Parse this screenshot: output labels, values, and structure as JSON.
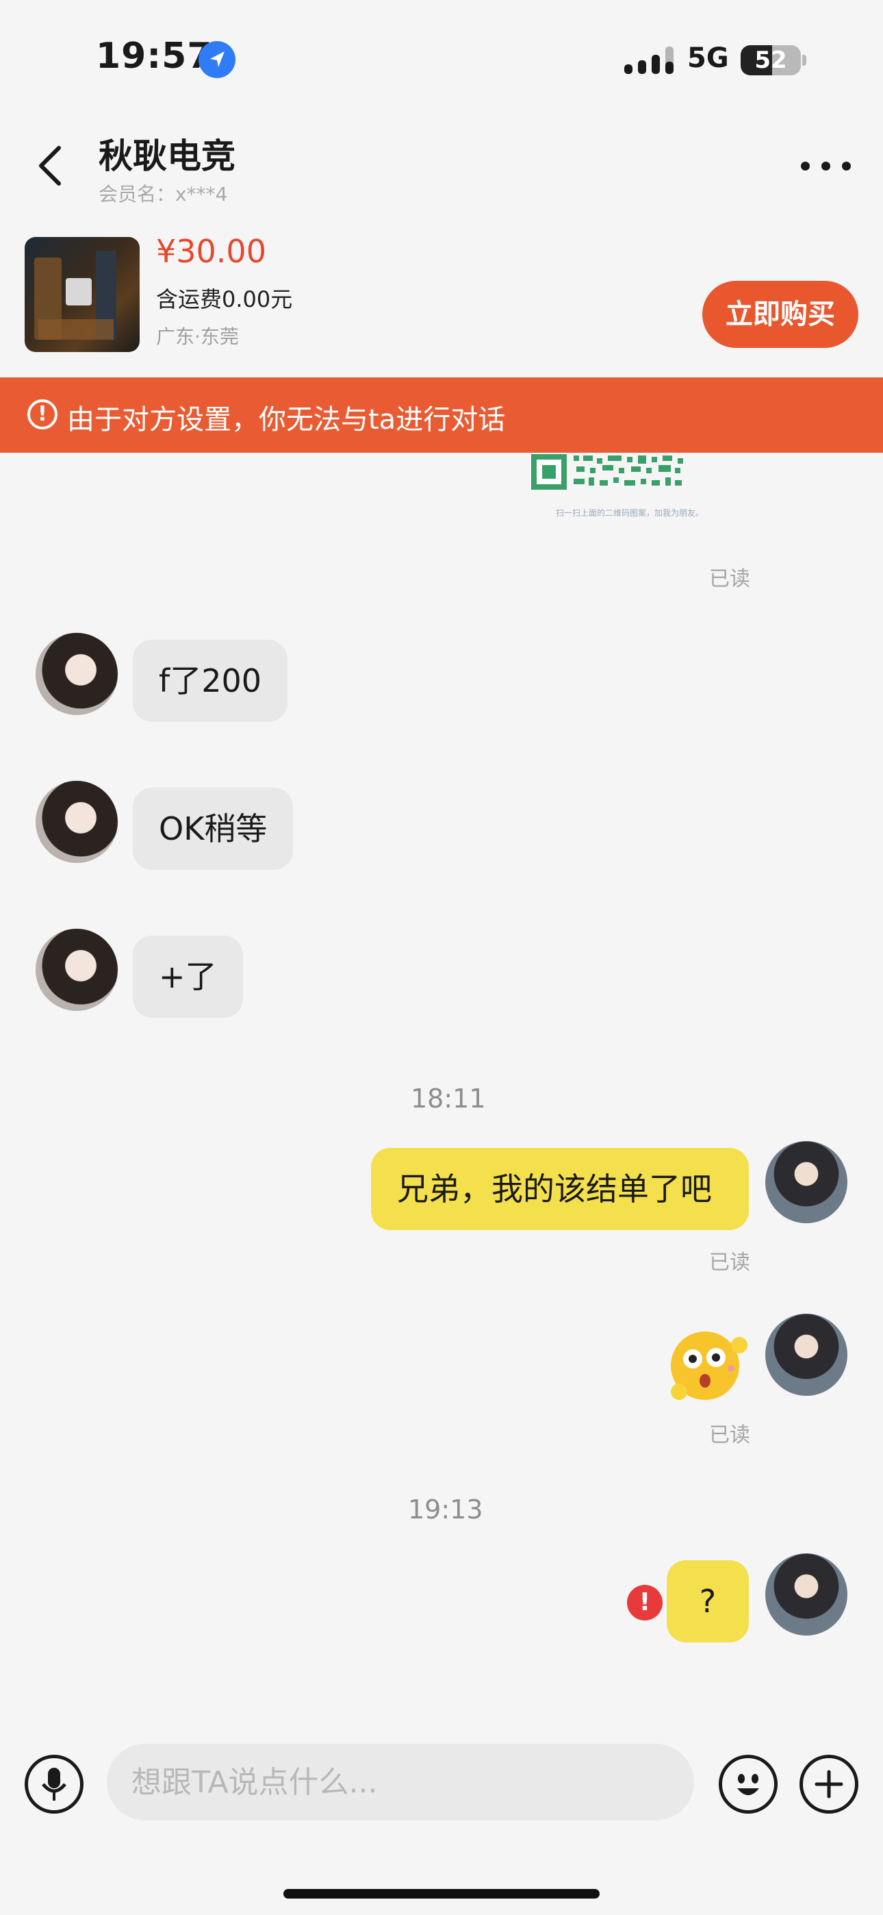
{
  "status_bar": {
    "time": "19:57",
    "network": "5G",
    "battery": "52",
    "battery_level": 0.52
  },
  "header": {
    "title": "秋耿电竞",
    "member_label": "会员名：x***4"
  },
  "product": {
    "price": "¥30.00",
    "shipping": "含运费0.00元",
    "location": "广东·东莞",
    "buy_label": "立即购买"
  },
  "warning": {
    "text": "由于对方设置，你无法与ta进行对话"
  },
  "qr_caption": "扫一扫上面的二维码图案，加我为朋友。",
  "messages": {
    "read_1": "已读",
    "in_1": "f了200",
    "in_2": "OK稍等",
    "in_3": "+了",
    "time_1": "18:11",
    "out_1": "兄弟，我的该结单了吧",
    "read_2": "已读",
    "read_3": "已读",
    "time_2": "19:13",
    "out_2": "?"
  },
  "input": {
    "placeholder": "想跟TA说点什么..."
  },
  "colors": {
    "accent": "#e8572d",
    "warning": "#e95c33",
    "price": "#e8472d",
    "bubble_out": "#f4e04d",
    "bubble_in": "#e8e8e8"
  },
  "icons": [
    "location-arrow-icon",
    "signal-icon",
    "battery-icon",
    "back-chevron-icon",
    "more-dots-icon",
    "alert-circle-icon",
    "error-icon",
    "microphone-icon",
    "emoji-icon",
    "plus-icon"
  ]
}
